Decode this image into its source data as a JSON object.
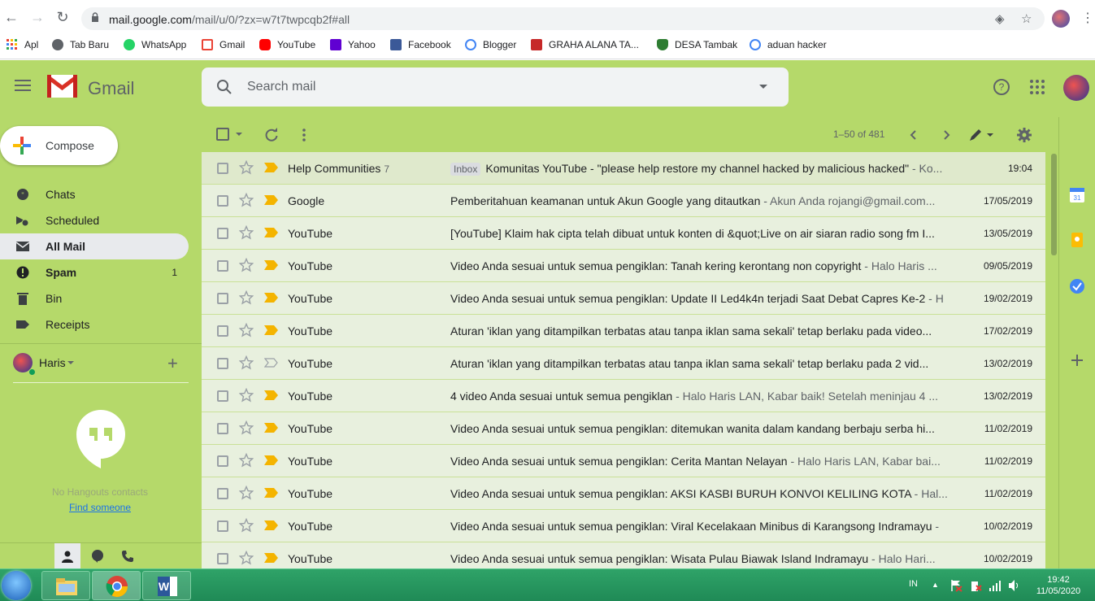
{
  "browser": {
    "url_host": "mail.google.com",
    "url_path": "/mail/u/0/?zx=w7t7twpcqb2f#all",
    "bookmarks": [
      {
        "label": "Apl",
        "icon": "apps-grid-icon"
      },
      {
        "label": "Tab Baru",
        "icon": "globe-icon"
      },
      {
        "label": "WhatsApp",
        "icon": "whatsapp-icon"
      },
      {
        "label": "Gmail",
        "icon": "gmail-icon"
      },
      {
        "label": "YouTube",
        "icon": "youtube-icon"
      },
      {
        "label": "Yahoo",
        "icon": "yahoo-icon"
      },
      {
        "label": "Facebook",
        "icon": "facebook-icon"
      },
      {
        "label": "Blogger",
        "icon": "google-icon"
      },
      {
        "label": "GRAHA ALANA TA...",
        "icon": "graha-icon"
      },
      {
        "label": "DESA Tambak",
        "icon": "shield-icon"
      },
      {
        "label": "aduan hacker",
        "icon": "google-icon"
      }
    ]
  },
  "header": {
    "app_name": "Gmail",
    "search_placeholder": "Search mail"
  },
  "sidebar": {
    "compose_label": "Compose",
    "items": [
      {
        "label": "Chats",
        "icon": "chat-icon",
        "count": ""
      },
      {
        "label": "Scheduled",
        "icon": "scheduled-icon",
        "count": ""
      },
      {
        "label": "All Mail",
        "icon": "mail-icon",
        "count": ""
      },
      {
        "label": "Spam",
        "icon": "spam-icon",
        "count": "1"
      },
      {
        "label": "Bin",
        "icon": "trash-icon",
        "count": ""
      },
      {
        "label": "Receipts",
        "icon": "label-icon",
        "count": ""
      }
    ],
    "hangouts": {
      "user_name": "Haris",
      "empty_text": "No Hangouts contacts",
      "find_link": "Find someone"
    }
  },
  "toolbar": {
    "page_range": "1–50 of 481"
  },
  "emails": [
    {
      "sender": "Help Communities",
      "count": "7",
      "label": "Inbox",
      "subject": "Komunitas YouTube - \"please help restore my channel hacked by malicious hacked\"",
      "snippet": " - Ko...",
      "date": "19:04",
      "important": true
    },
    {
      "sender": "Google",
      "count": "",
      "label": "",
      "subject": "Pemberitahuan keamanan untuk Akun Google yang ditautkan",
      "snippet": " - Akun Anda rojangi@gmail.com...",
      "date": "17/05/2019",
      "important": true
    },
    {
      "sender": "YouTube",
      "count": "",
      "label": "",
      "subject": "[YouTube] Klaim hak cipta telah dibuat untuk konten di &quot;Live on air siaran radio song fm I...",
      "snippet": "",
      "date": "13/05/2019",
      "important": true
    },
    {
      "sender": "YouTube",
      "count": "",
      "label": "",
      "subject": "Video Anda sesuai untuk semua pengiklan: Tanah kering kerontang non copyright",
      "snippet": " - Halo Haris ...",
      "date": "09/05/2019",
      "important": true
    },
    {
      "sender": "YouTube",
      "count": "",
      "label": "",
      "subject": "Video Anda sesuai untuk semua pengiklan: Update II Led4k4n terjadi Saat Debat Capres Ke-2",
      "snippet": " - H",
      "date": "19/02/2019",
      "important": true
    },
    {
      "sender": "YouTube",
      "count": "",
      "label": "",
      "subject": "Aturan 'iklan yang ditampilkan terbatas atau tanpa iklan sama sekali' tetap berlaku pada video...",
      "snippet": "",
      "date": "17/02/2019",
      "important": true
    },
    {
      "sender": "YouTube",
      "count": "",
      "label": "",
      "subject": "Aturan 'iklan yang ditampilkan terbatas atau tanpa iklan sama sekali' tetap berlaku pada 2 vid...",
      "snippet": "",
      "date": "13/02/2019",
      "important": false
    },
    {
      "sender": "YouTube",
      "count": "",
      "label": "",
      "subject": "4 video Anda sesuai untuk semua pengiklan",
      "snippet": " - Halo Haris LAN, Kabar baik! Setelah meninjau 4 ...",
      "date": "13/02/2019",
      "important": true
    },
    {
      "sender": "YouTube",
      "count": "",
      "label": "",
      "subject": "Video Anda sesuai untuk semua pengiklan: ditemukan wanita dalam kandang berbaju serba hi...",
      "snippet": "",
      "date": "11/02/2019",
      "important": true
    },
    {
      "sender": "YouTube",
      "count": "",
      "label": "",
      "subject": "Video Anda sesuai untuk semua pengiklan: Cerita Mantan Nelayan",
      "snippet": " - Halo Haris LAN, Kabar bai...",
      "date": "11/02/2019",
      "important": true
    },
    {
      "sender": "YouTube",
      "count": "",
      "label": "",
      "subject": "Video Anda sesuai untuk semua pengiklan: AKSI KASBI BURUH KONVOI KELILING KOTA",
      "snippet": " - Hal...",
      "date": "11/02/2019",
      "important": true
    },
    {
      "sender": "YouTube",
      "count": "",
      "label": "",
      "subject": "Video Anda sesuai untuk semua pengiklan: Viral Kecelakaan Minibus di Karangsong Indramayu",
      "snippet": " -",
      "date": "10/02/2019",
      "important": true
    },
    {
      "sender": "YouTube",
      "count": "",
      "label": "",
      "subject": "Video Anda sesuai untuk semua pengiklan: Wisata Pulau Biawak Island Indramayu",
      "snippet": " - Halo Hari...",
      "date": "10/02/2019",
      "important": true
    }
  ],
  "taskbar": {
    "language": "IN",
    "time": "19:42",
    "date": "11/05/2020"
  },
  "colors": {
    "theme_bg": "#b5d96a",
    "important_marker": "#f4b400",
    "row_bg": "#e8f0de",
    "taskbar": "#1f8a56"
  }
}
